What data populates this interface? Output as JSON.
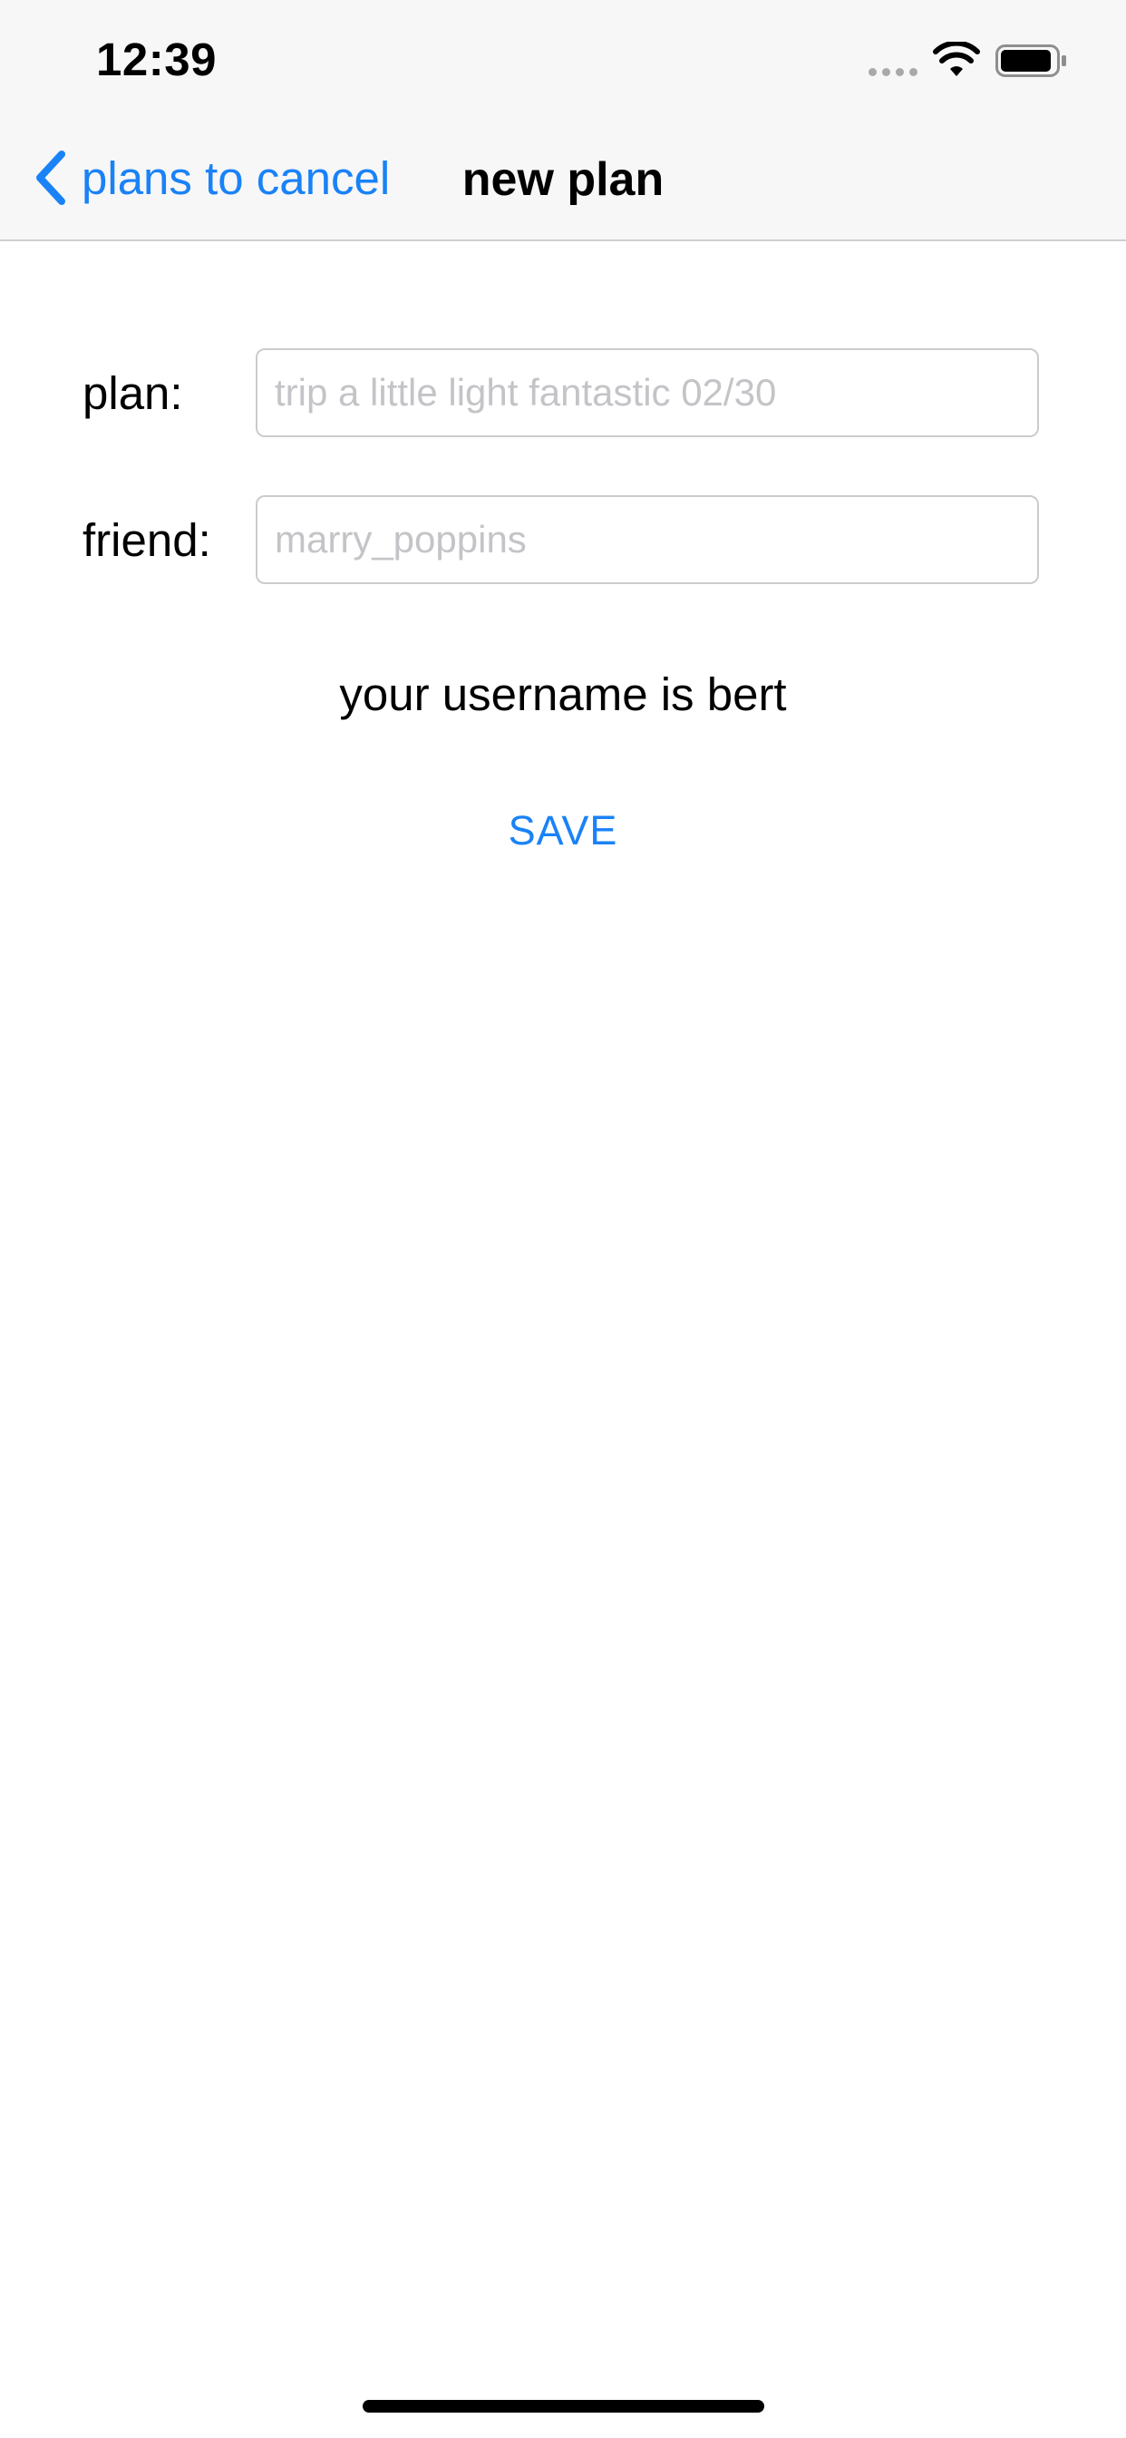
{
  "status_bar": {
    "time": "12:39"
  },
  "nav": {
    "back_label": "plans to cancel",
    "title": "new plan"
  },
  "form": {
    "plan_label": "plan:",
    "plan_placeholder": "trip a little light fantastic 02/30",
    "plan_value": "",
    "friend_label": "friend:",
    "friend_placeholder": "marry_poppins",
    "friend_value": ""
  },
  "username_text": "your username is bert",
  "save_label": "SAVE",
  "colors": {
    "accent": "#1a82f7",
    "placeholder": "#c4c4c8",
    "field_border": "#cccccc"
  },
  "icons": {
    "back": "chevron-left-icon",
    "wifi": "wifi-icon",
    "battery": "battery-icon",
    "signal": "signal-dots-icon"
  }
}
